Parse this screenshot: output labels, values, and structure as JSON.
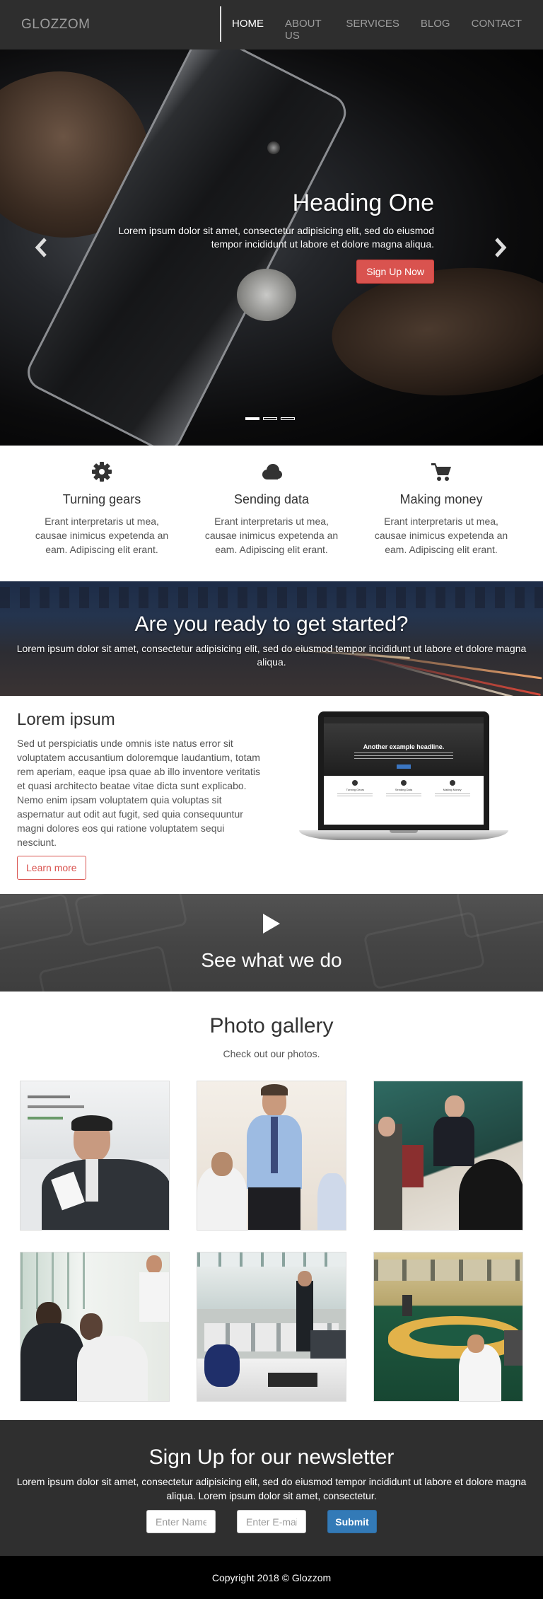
{
  "navbar": {
    "brand": "GLOZZOM",
    "items": [
      {
        "label": "HOME",
        "active": true
      },
      {
        "label": "ABOUT US"
      },
      {
        "label": "SERVICES"
      },
      {
        "label": "BLOG"
      },
      {
        "label": "CONTACT"
      }
    ]
  },
  "hero": {
    "heading": "Heading One",
    "text": "Lorem ipsum dolor sit amet, consectetur adipisicing elit, sed do eiusmod tempor incididunt ut labore et dolore magna aliqua.",
    "button": "Sign Up Now",
    "prev_icon": "chevron-left-icon",
    "next_icon": "chevron-right-icon",
    "slides": 3,
    "active_slide": 1
  },
  "features": [
    {
      "icon": "gear-icon",
      "title": "Turning gears",
      "text": "Erant interpretaris ut mea, causae inimicus expetenda an eam. Adipiscing elit erant."
    },
    {
      "icon": "cloud-icon",
      "title": "Sending data",
      "text": "Erant interpretaris ut mea, causae inimicus expetenda an eam. Adipiscing elit erant."
    },
    {
      "icon": "cart-icon",
      "title": "Making money",
      "text": "Erant interpretaris ut mea, causae inimicus expetenda an eam. Adipiscing elit erant."
    }
  ],
  "ready": {
    "heading": "Are you ready to get started?",
    "text": "Lorem ipsum dolor sit amet, consectetur adipisicing elit, sed do eiusmod tempor incididunt ut labore et dolore magna aliqua."
  },
  "about": {
    "heading": "Lorem ipsum",
    "text": "Sed ut perspiciatis unde omnis iste natus error sit voluptatem accusantium doloremque laudantium, totam rem aperiam, eaque ipsa quae ab illo inventore veritatis et quasi architecto beatae vitae dicta sunt explicabo. Nemo enim ipsam voluptatem quia voluptas sit aspernatur aut odit aut fugit, sed quia consequuntur magni dolores eos qui ratione voluptatem sequi nesciunt.",
    "button": "Learn more",
    "laptop_headline": "Another example headline.",
    "laptop_features": [
      "Turning Gears",
      "Sending Data",
      "Making Money"
    ]
  },
  "video": {
    "icon": "play-icon",
    "heading": "See what we do"
  },
  "gallery": {
    "heading": "Photo gallery",
    "subheading": "Check out our photos.",
    "photos": [
      {
        "name": "presenter-photo"
      },
      {
        "name": "businessman-photo"
      },
      {
        "name": "meeting-photo"
      },
      {
        "name": "office-team-photo"
      },
      {
        "name": "open-office-photo"
      },
      {
        "name": "conference-room-photo"
      }
    ]
  },
  "newsletter": {
    "heading": "Sign Up for our newsletter",
    "text": "Lorem ipsum dolor sit amet, consectetur adipisicing elit, sed do eiusmod tempor incididunt ut labore et dolore magna aliqua. Lorem ipsum dolor sit amet, consectetur.",
    "name_placeholder": "Enter Name",
    "email_placeholder": "Enter E-mail",
    "button": "Submit"
  },
  "footer": {
    "copyright": "Copyright 2018 © Glozzom"
  },
  "colors": {
    "navbar_bg": "#2e2e2e",
    "accent_red": "#d9534f",
    "accent_blue": "#337ab7",
    "footer_bg": "#000000"
  }
}
